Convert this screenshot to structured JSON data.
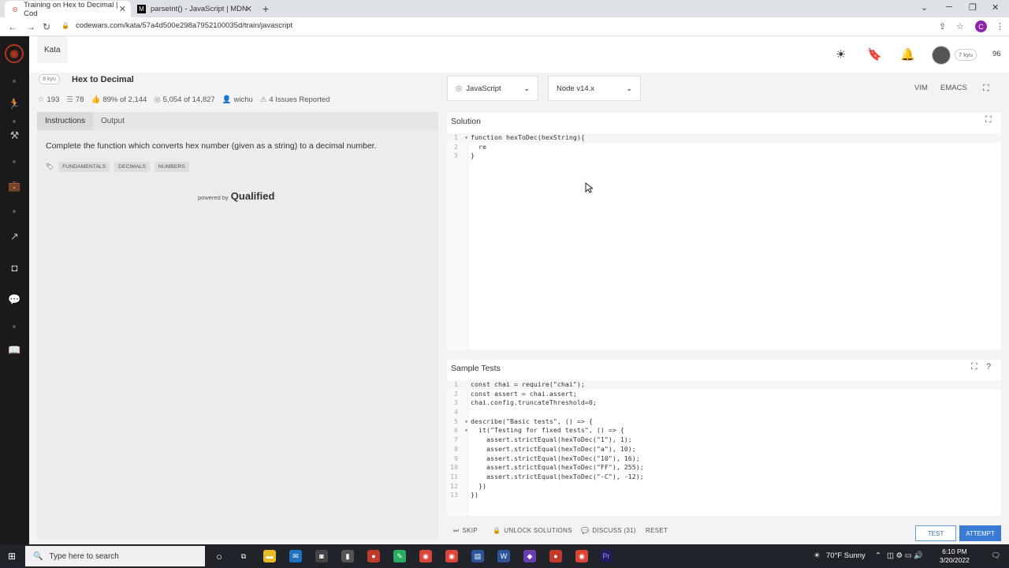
{
  "browser": {
    "tabs": [
      {
        "title": "Training on Hex to Decimal | Cod",
        "active": true
      },
      {
        "title": "parseInt() - JavaScript | MDN",
        "active": false
      }
    ],
    "url": "codewars.com/kata/57a4d500e298a7952100035d/train/javascript"
  },
  "header": {
    "kata_tab": "Kata",
    "rank_badge": "7 kyu",
    "honor": "96"
  },
  "kata": {
    "kyu": "8 kyu",
    "title": "Hex to Decimal",
    "stats": {
      "stars": "193",
      "collections": "78",
      "satisfaction": "89% of 2,144",
      "completions": "5,054 of 14,827",
      "author": "wichu",
      "issues": "4 Issues Reported"
    }
  },
  "left_panel": {
    "tabs": [
      "Instructions",
      "Output"
    ],
    "description": "Complete the function which converts hex number (given as a string) to a decimal number.",
    "tags": [
      "FUNDAMENTALS",
      "DECIMALS",
      "NUMBERS"
    ],
    "powered_by": "powered by",
    "qualified": "Qualified"
  },
  "editor": {
    "language": "JavaScript",
    "runtime": "Node v14.x",
    "modes": [
      "VIM",
      "EMACS"
    ],
    "solution_title": "Solution",
    "solution_lines": [
      {
        "n": "1",
        "fold": "▾",
        "text": "function hexToDec(hexString){"
      },
      {
        "n": "2",
        "fold": "",
        "text": "  re"
      },
      {
        "n": "3",
        "fold": "",
        "text": "}"
      }
    ],
    "tests_title": "Sample Tests",
    "test_lines": [
      {
        "n": "1",
        "fold": "",
        "text": "const chai = require(\"chai\");"
      },
      {
        "n": "2",
        "fold": "",
        "text": "const assert = chai.assert;"
      },
      {
        "n": "3",
        "fold": "",
        "text": "chai.config.truncateThreshold=0;"
      },
      {
        "n": "4",
        "fold": "",
        "text": ""
      },
      {
        "n": "5",
        "fold": "▾",
        "text": "describe(\"Basic tests\", () => {"
      },
      {
        "n": "6",
        "fold": "▾",
        "text": "  it(\"Testing for fixed tests\", () => {"
      },
      {
        "n": "7",
        "fold": "",
        "text": "    assert.strictEqual(hexToDec(\"1\"), 1);"
      },
      {
        "n": "8",
        "fold": "",
        "text": "    assert.strictEqual(hexToDec(\"a\"), 10);"
      },
      {
        "n": "9",
        "fold": "",
        "text": "    assert.strictEqual(hexToDec(\"10\"), 16);"
      },
      {
        "n": "10",
        "fold": "",
        "text": "    assert.strictEqual(hexToDec(\"FF\"), 255);"
      },
      {
        "n": "11",
        "fold": "",
        "text": "    assert.strictEqual(hexToDec(\"-C\"), -12);"
      },
      {
        "n": "12",
        "fold": "",
        "text": "  })"
      },
      {
        "n": "13",
        "fold": "",
        "text": "})"
      }
    ]
  },
  "actions": {
    "skip": "SKIP",
    "unlock": "UNLOCK SOLUTIONS",
    "discuss": "DISCUSS (31)",
    "reset": "RESET",
    "test": "TEST",
    "attempt": "ATTEMPT"
  },
  "taskbar": {
    "search_placeholder": "Type here to search",
    "weather": "70°F  Sunny",
    "time": "6:10 PM",
    "date": "3/20/2022"
  }
}
